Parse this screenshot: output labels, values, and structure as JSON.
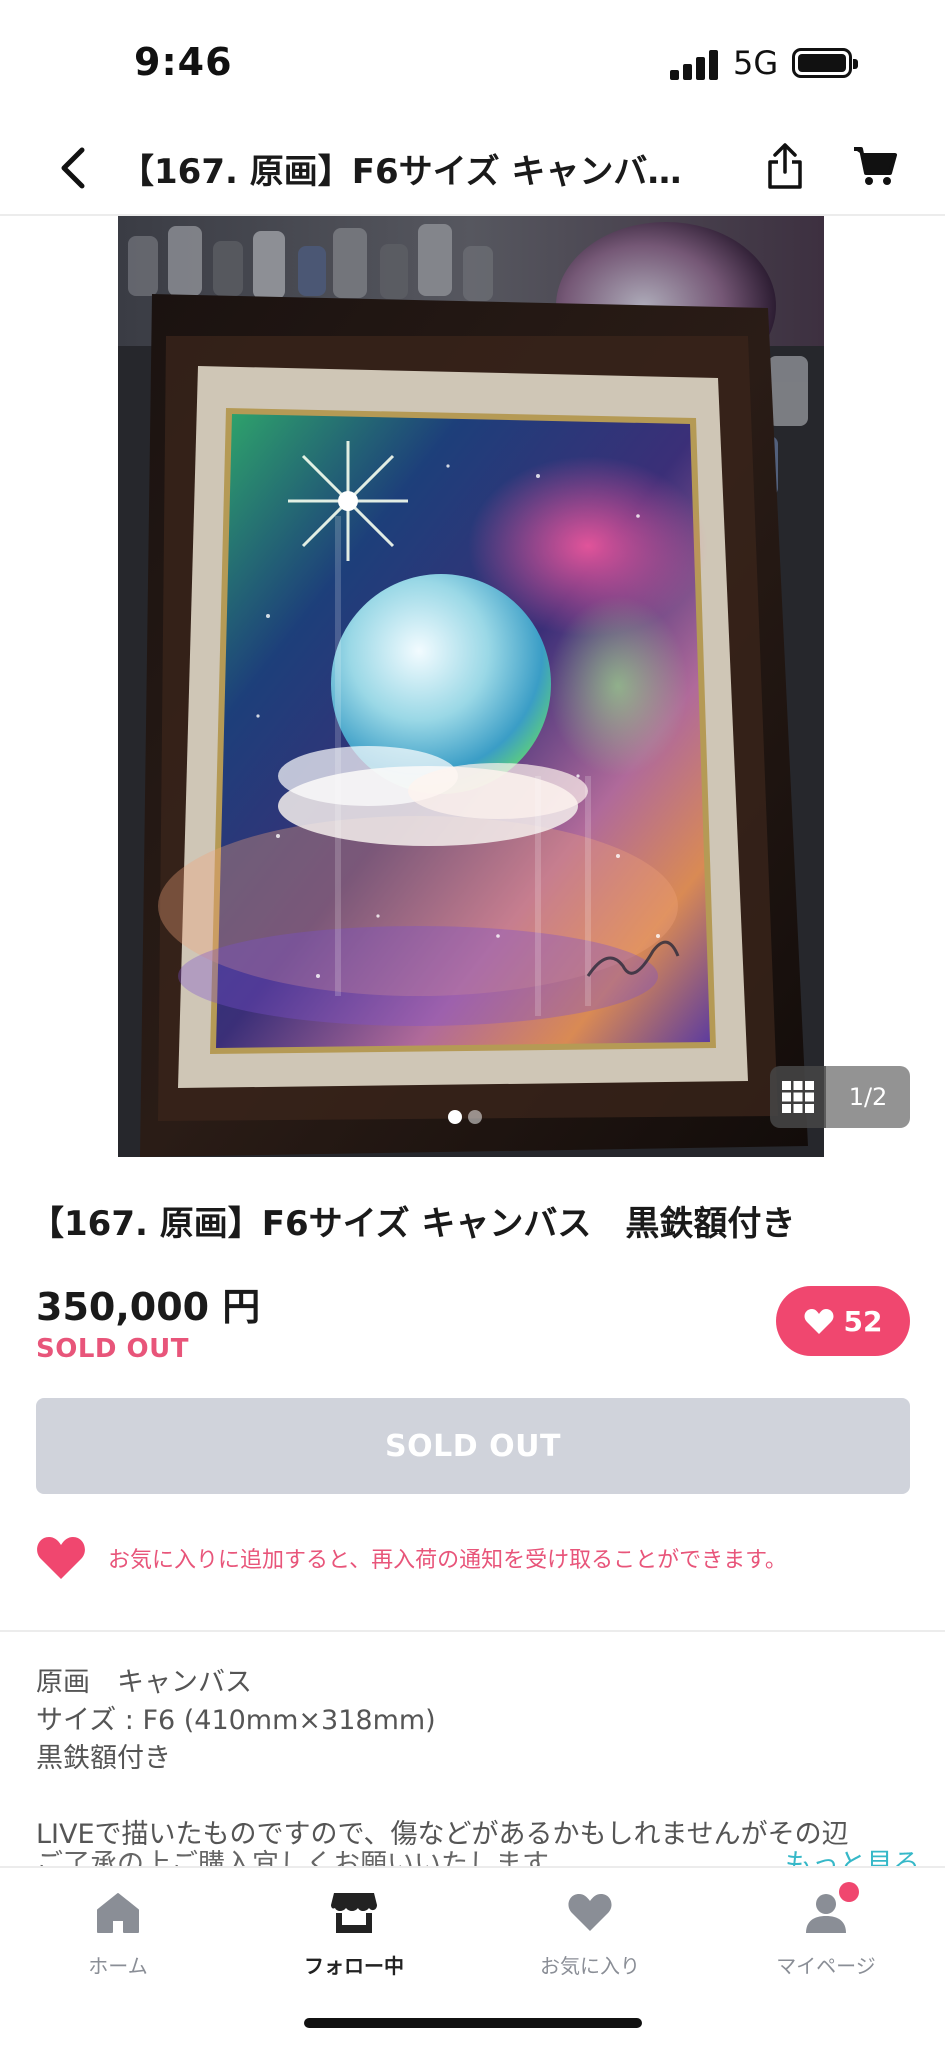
{
  "status_bar": {
    "time": "9:46",
    "network": "5G"
  },
  "nav": {
    "title": "【167. 原画】F6サイズ キャンバス…"
  },
  "gallery": {
    "counter": "1/2",
    "total_dots": 2,
    "active_dot": 1
  },
  "product": {
    "title": "【167. 原画】F6サイズ キャンバス　黒鉄額付き",
    "price": "350,000 円",
    "status": "SOLD OUT",
    "like_count": "52"
  },
  "purchase_button": {
    "label": "SOLD OUT"
  },
  "favorite_notice": {
    "text": "お気に入りに追加すると、再入荷の通知を受け取ることができます。"
  },
  "description": {
    "lines": [
      "原画　キャンバス",
      "サイズ : F6 (410mm×318mm)",
      "黒鉄額付き"
    ],
    "paragraph": "LIVEで描いたものですので、傷などがあるかもしれませんがその辺",
    "paragraph_cut": "ご了承の上ご購入宜しくお願いいたします。",
    "more": "もっと見る"
  },
  "tabs": [
    {
      "label": "ホーム",
      "icon": "home-icon"
    },
    {
      "label": "フォロー中",
      "icon": "store-icon"
    },
    {
      "label": "お気に入り",
      "icon": "heart-icon"
    },
    {
      "label": "マイページ",
      "icon": "person-icon"
    }
  ],
  "colors": {
    "accent": "#f0476f",
    "sold_text": "#e8557a",
    "disabled_button": "#d0d3db",
    "link": "#36b8c8",
    "tab_inactive": "#8a8e96"
  }
}
